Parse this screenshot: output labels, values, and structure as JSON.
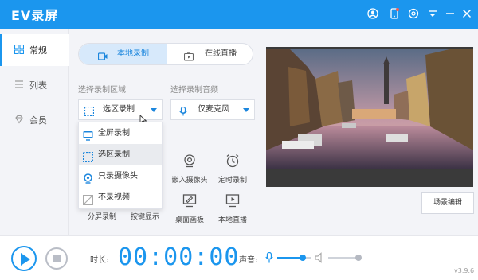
{
  "app": {
    "title": "EV录屏"
  },
  "colors": {
    "accent": "#1b96ee"
  },
  "titlebar_icons": [
    "user-icon",
    "phone-icon",
    "settings-icon",
    "menu-icon",
    "minimize-icon",
    "close-icon"
  ],
  "sidebar": {
    "items": [
      {
        "label": "常规",
        "icon": "grid-icon"
      },
      {
        "label": "列表",
        "icon": "list-icon"
      },
      {
        "label": "会员",
        "icon": "diamond-icon"
      }
    ]
  },
  "tabs": {
    "local": "本地录制",
    "live": "在线直播"
  },
  "record_area": {
    "label": "选择录制区域",
    "value": "选区录制"
  },
  "audio": {
    "label": "选择录制音频",
    "value": "仅麦克风"
  },
  "area_options": [
    {
      "label": "全屏录制",
      "icon": "monitor-icon"
    },
    {
      "label": "选区录制",
      "icon": "region-icon"
    },
    {
      "label": "只录摄像头",
      "icon": "camera-icon"
    },
    {
      "label": "不录视频",
      "icon": "no-video-icon"
    }
  ],
  "tools": {
    "split": "分屏录制",
    "hotkey": "按键显示",
    "webcam": "嵌入摄像头",
    "timer": "定时录制",
    "whiteboard": "桌面画板",
    "live": "本地直播"
  },
  "scene_edit": "场景编辑",
  "duration": {
    "label": "时长:",
    "value": "00:00:00"
  },
  "volume": {
    "label": "声音:",
    "mic_level": 0.75,
    "speaker_level": 1.0
  },
  "version": "v3.9.6"
}
